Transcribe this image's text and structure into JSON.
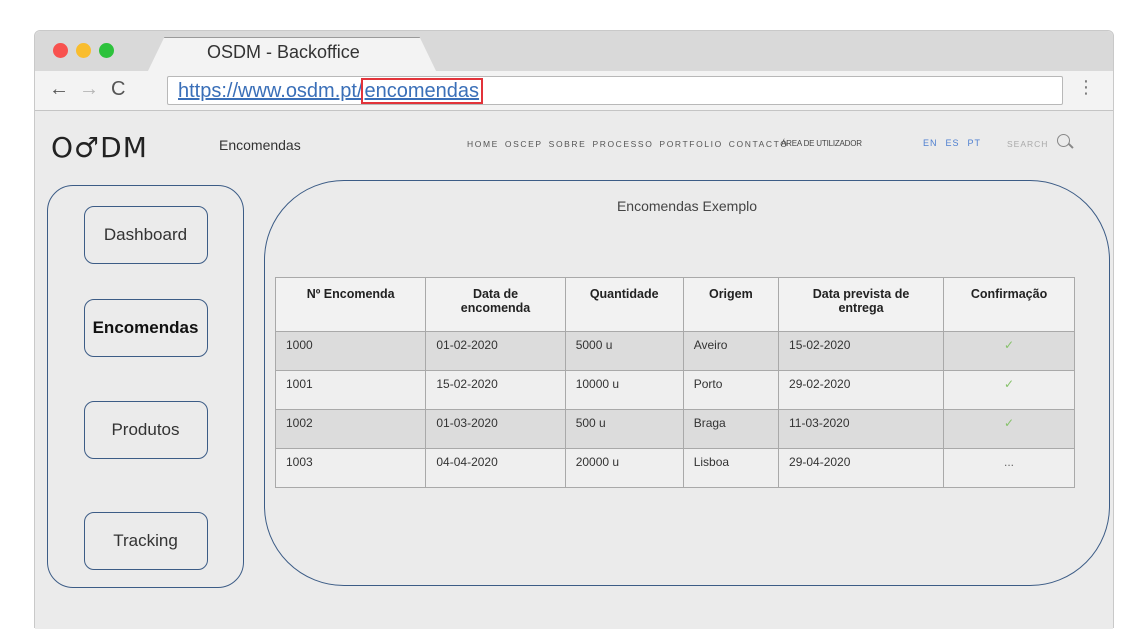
{
  "browser": {
    "tab_title": "OSDM - Backoffice",
    "url_base": "https://www.osdm.pt/",
    "url_path": "encomendas",
    "nav": {
      "back": "←",
      "forward": "→",
      "reload": "C",
      "menu": "⋮"
    }
  },
  "header": {
    "logo": "O♂DM",
    "page_title": "Encomendas",
    "nav_items": [
      "HOME",
      "OSCEP",
      "SOBRE",
      "PROCESSO",
      "PORTFOLIO",
      "CONTACTO"
    ],
    "user_area": "ÁREA DE UTILIZADOR",
    "languages": [
      "EN",
      "ES",
      "PT"
    ],
    "search_label": "SEARCH"
  },
  "sidebar": {
    "items": [
      {
        "label": "Dashboard",
        "active": false
      },
      {
        "label": "Encomendas",
        "active": true
      },
      {
        "label": "Produtos",
        "active": false
      },
      {
        "label": "Tracking",
        "active": false
      }
    ]
  },
  "main": {
    "title": "Encomendas Exemplo",
    "table": {
      "headers": [
        "Nº Encomenda",
        "Data de\nencomenda",
        "Quantidade",
        "Origem",
        "Data prevista de\nentrega",
        "Confirmação"
      ],
      "rows": [
        [
          "1000",
          "01-02-2020",
          "5000 u",
          "Aveiro",
          "15-02-2020",
          "✓"
        ],
        [
          "1001",
          "15-02-2020",
          "10000 u",
          "Porto",
          "29-02-2020",
          "✓"
        ],
        [
          "1002",
          "01-03-2020",
          "500 u",
          "Braga",
          "11-03-2020",
          "✓"
        ],
        [
          "1003",
          "04-04-2020",
          "20000 u",
          "Lisboa",
          "29-04-2020",
          "..."
        ]
      ]
    }
  },
  "colors": {
    "accent_border": "#3c5c86",
    "url_highlight": "#e2333a",
    "link_blue": "#3a6fb8",
    "check_green": "#86c26a"
  }
}
